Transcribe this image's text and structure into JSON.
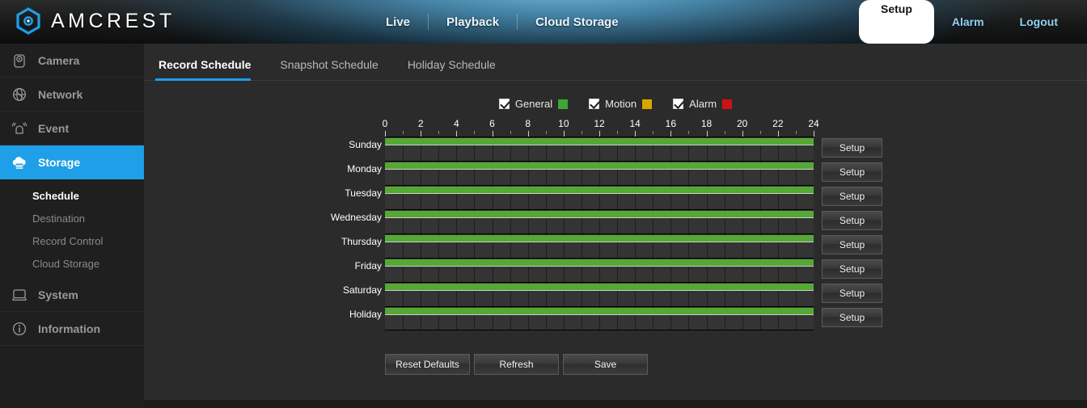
{
  "header": {
    "brand": "AMCREST",
    "logo_icon": "hexagon-logo-icon",
    "nav": [
      {
        "label": "Live"
      },
      {
        "label": "Playback"
      },
      {
        "label": "Cloud Storage"
      }
    ],
    "right_nav": [
      {
        "label": "Setup",
        "active": true
      },
      {
        "label": "Alarm",
        "active": false
      },
      {
        "label": "Logout",
        "active": false
      }
    ]
  },
  "sidebar": {
    "items": [
      {
        "label": "Camera",
        "icon": "camera-icon",
        "active": false
      },
      {
        "label": "Network",
        "icon": "globe-network-icon",
        "active": false
      },
      {
        "label": "Event",
        "icon": "alarm-bell-icon",
        "active": false
      },
      {
        "label": "Storage",
        "icon": "cloud-storage-icon",
        "active": true
      },
      {
        "label": "System",
        "icon": "monitor-system-icon",
        "active": false
      },
      {
        "label": "Information",
        "icon": "info-circle-icon",
        "active": false
      }
    ],
    "sub_items": [
      {
        "label": "Schedule",
        "active": true
      },
      {
        "label": "Destination",
        "active": false
      },
      {
        "label": "Record Control",
        "active": false
      },
      {
        "label": "Cloud Storage",
        "active": false
      }
    ]
  },
  "tabs": [
    {
      "label": "Record Schedule",
      "active": true
    },
    {
      "label": "Snapshot Schedule",
      "active": false
    },
    {
      "label": "Holiday Schedule",
      "active": false
    }
  ],
  "legend": [
    {
      "label": "General",
      "color": "#3FA535",
      "checked": true
    },
    {
      "label": "Motion",
      "color": "#D9A400",
      "checked": true
    },
    {
      "label": "Alarm",
      "color": "#CC1414",
      "checked": true
    }
  ],
  "schedule": {
    "axis_labels": [
      "0",
      "2",
      "4",
      "6",
      "8",
      "10",
      "12",
      "14",
      "16",
      "18",
      "20",
      "22",
      "24"
    ],
    "axis_min": 0,
    "axis_max": 24,
    "setup_button_label": "Setup",
    "rows": [
      {
        "day": "Sunday",
        "general_start": 0,
        "general_end": 24
      },
      {
        "day": "Monday",
        "general_start": 0,
        "general_end": 24
      },
      {
        "day": "Tuesday",
        "general_start": 0,
        "general_end": 24
      },
      {
        "day": "Wednesday",
        "general_start": 0,
        "general_end": 24
      },
      {
        "day": "Thursday",
        "general_start": 0,
        "general_end": 24
      },
      {
        "day": "Friday",
        "general_start": 0,
        "general_end": 24
      },
      {
        "day": "Saturday",
        "general_start": 0,
        "general_end": 24
      },
      {
        "day": "Holiday",
        "general_start": 0,
        "general_end": 24
      }
    ]
  },
  "actions": [
    {
      "label": "Reset Defaults"
    },
    {
      "label": "Refresh"
    },
    {
      "label": "Save"
    }
  ],
  "colors": {
    "accent": "#1E9FE8",
    "general": "#55A834",
    "motion": "#D9A400",
    "alarm": "#CC1414"
  }
}
